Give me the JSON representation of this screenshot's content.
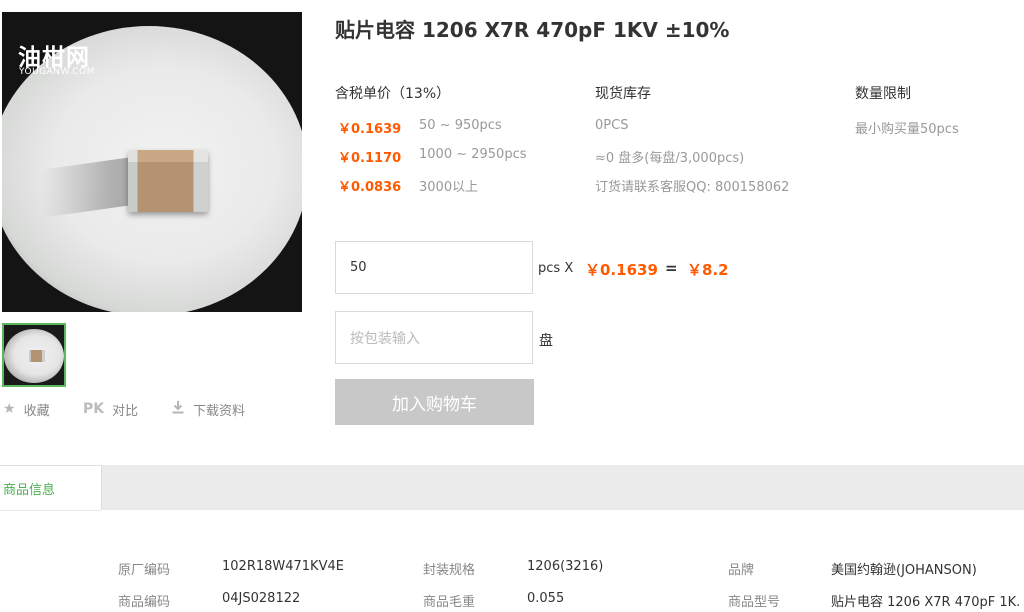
{
  "image": {
    "logo_cn": "油柑网",
    "logo_en": "YOUGANW.COM"
  },
  "actions": {
    "favorite": "收藏",
    "compare_pk": "PK",
    "compare": "对比",
    "download": "下载资料"
  },
  "product": {
    "title": "贴片电容 1206 X7R 470pF 1KV ±10%"
  },
  "price_header": "含税单价（13%）",
  "stock_header": "现货库存",
  "limit_header": "数量限制",
  "tiers": [
    {
      "price": "￥0.1639",
      "range": "50 ~ 950pcs"
    },
    {
      "price": "￥0.1170",
      "range": "1000 ~ 2950pcs"
    },
    {
      "price": "￥0.0836",
      "range": "3000以上"
    }
  ],
  "stock": [
    "0PCS",
    "≈0 盘多(每盘/3,000pcs)",
    "订货请联系客服QQ: 800158062"
  ],
  "limit": "最小购买量50pcs",
  "order": {
    "qty_value": "50",
    "unit": "pcs",
    "times": "X",
    "unit_price": "￥0.1639",
    "equals": "=",
    "total": "￥8.2",
    "reel_placeholder": "按包装输入",
    "reel_unit": "盘",
    "add_to_cart": "加入购物车"
  },
  "tabs": {
    "product_info": "商品信息"
  },
  "info": {
    "r1": [
      {
        "label": "原厂编码",
        "value": "102R18W471KV4E"
      },
      {
        "label": "封装规格",
        "value": "1206(3216)"
      },
      {
        "label": "品牌",
        "value": "美国约翰逊(JOHANSON)"
      }
    ],
    "r2": [
      {
        "label": "商品编码",
        "value": "04JS028122"
      },
      {
        "label": "商品毛重",
        "value": "0.055"
      },
      {
        "label": "商品型号",
        "value": "贴片电容 1206 X7R 470pF 1K."
      }
    ]
  },
  "colors": {
    "price_orange": "#ff5a00",
    "tab_green": "#4caf50",
    "button_grey": "#c8c8c8"
  }
}
